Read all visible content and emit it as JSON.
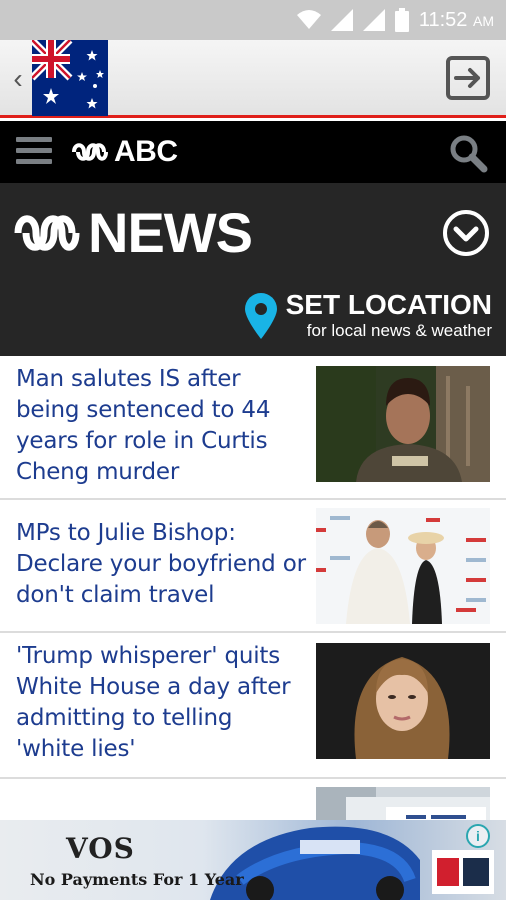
{
  "status_bar": {
    "time": "11:52",
    "ampm": "AM"
  },
  "app_bar": {
    "icons": {
      "back": "chevron-left-icon",
      "flag": "australian-flag",
      "exit": "exit-icon"
    }
  },
  "abc_header": {
    "brand": "ABC",
    "icons": {
      "menu": "hamburger-icon",
      "search": "search-icon"
    }
  },
  "news_banner": {
    "title": "NEWS",
    "set_location_title": "SET LOCATION",
    "set_location_subtitle": "for local news & weather",
    "icons": {
      "dropdown": "chevron-down-circle-icon",
      "pin": "location-pin-icon"
    }
  },
  "articles": [
    {
      "title": "Man salutes IS after being sentenced to 44 years for role in Curtis Cheng murder"
    },
    {
      "title": "MPs to Julie Bishop: Declare your boyfriend or don't claim travel"
    },
    {
      "title": "'Trump whisperer' quits White House a day after admitting to telling 'white lies'"
    },
    {
      "title": ""
    }
  ],
  "ad": {
    "brand": "VOS",
    "tagline": "No Payments For 1 Year",
    "info": "i"
  },
  "colors": {
    "accent_red": "#e0201a",
    "headline_blue": "#1d3c8f",
    "banner_bg": "#262626"
  }
}
